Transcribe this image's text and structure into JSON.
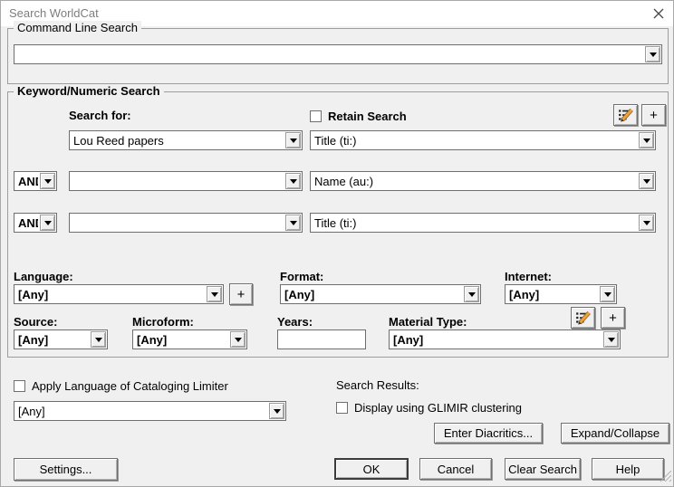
{
  "window": {
    "title": "Search WorldCat"
  },
  "command_line": {
    "group_label": "Command Line Search",
    "value": ""
  },
  "keyword": {
    "group_label": "Keyword/Numeric Search",
    "search_for_label": "Search for:",
    "retain_search_label": "Retain Search",
    "plus_label": "+",
    "rows": [
      {
        "op": "",
        "term": "Lou Reed papers",
        "index": "Title (ti:)"
      },
      {
        "op": "AND",
        "term": "",
        "index": "Name (au:)"
      },
      {
        "op": "AND",
        "term": "",
        "index": "Title (ti:)"
      }
    ],
    "limiters": {
      "language": {
        "label": "Language:",
        "value": "[Any]"
      },
      "format": {
        "label": "Format:",
        "value": "[Any]"
      },
      "internet": {
        "label": "Internet:",
        "value": "[Any]"
      },
      "source": {
        "label": "Source:",
        "value": "[Any]"
      },
      "microform": {
        "label": "Microform:",
        "value": "[Any]"
      },
      "years": {
        "label": "Years:",
        "value": ""
      },
      "material_type": {
        "label": "Material Type:",
        "value": "[Any]"
      }
    }
  },
  "footer": {
    "apply_language_label": "Apply Language of Cataloging Limiter",
    "apply_language_value": "[Any]",
    "search_results_label": "Search Results:",
    "glimir_label": "Display using GLIMIR clustering",
    "enter_diacritics_label": "Enter Diacritics...",
    "expand_collapse_label": "Expand/Collapse"
  },
  "buttons": {
    "settings": "Settings...",
    "ok": "OK",
    "cancel": "Cancel",
    "clear_search": "Clear Search",
    "help": "Help"
  },
  "colors": {
    "dialog_bg": "#f0f0f0",
    "titlebar_bg": "#ffffff",
    "title_text": "#7d7d7d",
    "pencil_icon": "#e8953a"
  }
}
